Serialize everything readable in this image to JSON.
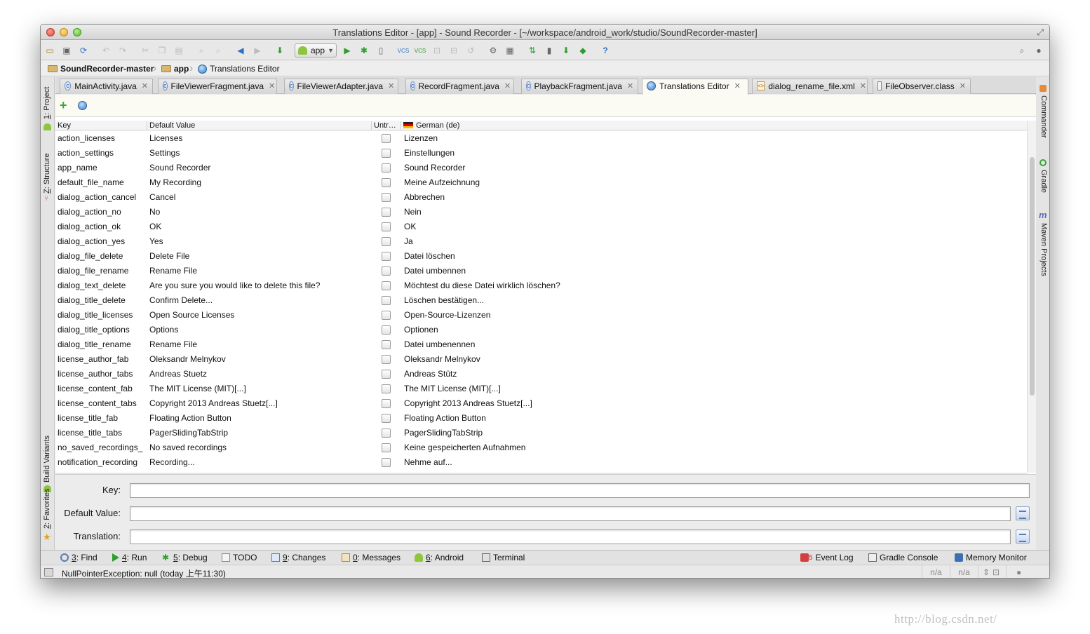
{
  "window": {
    "title": "Translations Editor - [app] - Sound Recorder - [~/workspace/android_work/studio/SoundRecorder-master]"
  },
  "toolbar": {
    "run_config": "app",
    "vcs_update_label": "VCS",
    "vcs_commit_label": "VCS",
    "help_label": "?"
  },
  "breadcrumb": [
    "SoundRecorder-master",
    "app",
    "Translations Editor"
  ],
  "left_tool_tabs": {
    "project": {
      "num": "1",
      "label": ": Project"
    },
    "structure": {
      "num": "Z",
      "label": ": Structure"
    },
    "build_variants": "Build Variants",
    "favorites": {
      "num": "2",
      "label": ": Favorites"
    }
  },
  "right_tool_tabs": [
    "Commander",
    "Gradle",
    "Maven Projects"
  ],
  "editor_tabs": [
    {
      "label": "MainActivity.java",
      "kind": "class-icon"
    },
    {
      "label": "FileViewerFragment.java",
      "kind": "class-icon"
    },
    {
      "label": "FileViewerAdapter.java",
      "kind": "class-icon"
    },
    {
      "label": "RecordFragment.java",
      "kind": "class-icon"
    },
    {
      "label": "PlaybackFragment.java",
      "kind": "class-icon"
    },
    {
      "label": "Translations Editor",
      "kind": "globe-icon",
      "active": true
    },
    {
      "label": "dialog_rename_file.xml",
      "kind": "xml-icon"
    },
    {
      "label": "FileObserver.class",
      "kind": "classfile-icon"
    }
  ],
  "table": {
    "columns": [
      "Key",
      "Default Value",
      "Untr…",
      "German (de)"
    ],
    "rows": [
      {
        "key": "action_licenses",
        "default": "Licenses",
        "de": "Lizenzen"
      },
      {
        "key": "action_settings",
        "default": "Settings",
        "de": "Einstellungen"
      },
      {
        "key": "app_name",
        "default": "Sound Recorder",
        "de": "Sound Recorder"
      },
      {
        "key": "default_file_name",
        "default": "My Recording",
        "de": "Meine Aufzeichnung"
      },
      {
        "key": "dialog_action_cancel",
        "default": "Cancel",
        "de": "Abbrechen"
      },
      {
        "key": "dialog_action_no",
        "default": "No",
        "de": "Nein"
      },
      {
        "key": "dialog_action_ok",
        "default": "OK",
        "de": "OK"
      },
      {
        "key": "dialog_action_yes",
        "default": "Yes",
        "de": "Ja"
      },
      {
        "key": "dialog_file_delete",
        "default": "Delete File",
        "de": "Datei löschen"
      },
      {
        "key": "dialog_file_rename",
        "default": "Rename File",
        "de": "Datei umbennen"
      },
      {
        "key": "dialog_text_delete",
        "default": "Are you sure you would like to delete this file?",
        "de": "Möchtest du diese Datei wirklich löschen?"
      },
      {
        "key": "dialog_title_delete",
        "default": "Confirm Delete...",
        "de": "Löschen bestätigen..."
      },
      {
        "key": "dialog_title_licenses",
        "default": "Open Source Licenses",
        "de": "Open-Source-Lizenzen"
      },
      {
        "key": "dialog_title_options",
        "default": "Options",
        "de": "Optionen"
      },
      {
        "key": "dialog_title_rename",
        "default": "Rename File",
        "de": "Datei umbenennen"
      },
      {
        "key": "license_author_fab",
        "default": "Oleksandr Melnykov",
        "de": "Oleksandr Melnykov"
      },
      {
        "key": "license_author_tabs",
        "default": "Andreas Stuetz",
        "de": "Andreas Stütz"
      },
      {
        "key": "license_content_fab",
        "default": "The MIT License (MIT)[...]",
        "de": "The MIT License (MIT)[...]"
      },
      {
        "key": "license_content_tabs",
        "default": "Copyright 2013 Andreas Stuetz[...]",
        "de": "Copyright 2013 Andreas Stuetz[...]"
      },
      {
        "key": "license_title_fab",
        "default": "Floating Action Button",
        "de": "Floating Action Button"
      },
      {
        "key": "license_title_tabs",
        "default": "PagerSlidingTabStrip",
        "de": "PagerSlidingTabStrip"
      },
      {
        "key": "no_saved_recordings_",
        "default": "No saved recordings",
        "de": "Keine gespeicherten Aufnahmen"
      },
      {
        "key": "notification_recording",
        "default": "Recording...",
        "de": "Nehme auf..."
      }
    ]
  },
  "form": {
    "key_label": "Key:",
    "default_label": "Default Value:",
    "translation_label": "Translation:",
    "key_value": "",
    "default_value": "",
    "translation_value": ""
  },
  "tool_windows_left": [
    {
      "num": "3",
      "label": ": Find",
      "icon": "search-icon"
    },
    {
      "num": "4",
      "label": ": Run",
      "icon": "run-icon"
    },
    {
      "num": "5",
      "label": ": Debug",
      "icon": "bug-icon"
    },
    {
      "num": "",
      "label": "TODO",
      "icon": "todo-icon"
    },
    {
      "num": "9",
      "label": ": Changes",
      "icon": "changes-icon"
    },
    {
      "num": "0",
      "label": ": Messages",
      "icon": "messages-icon"
    },
    {
      "num": "6",
      "label": ": Android",
      "icon": "android-icon"
    },
    {
      "num": "",
      "label": "Terminal",
      "icon": "terminal-icon"
    }
  ],
  "tool_windows_right": [
    {
      "badge": "5",
      "label": "Event Log",
      "icon": "event-log-icon"
    },
    {
      "badge": "",
      "label": "Gradle Console",
      "icon": "gradle-console-icon"
    },
    {
      "badge": "",
      "label": "Memory Monitor",
      "icon": "memory-monitor-icon"
    }
  ],
  "status": {
    "message": "NullPointerException: null (today 上午11:30)",
    "cell1": "n/a",
    "cell2": "n/a"
  },
  "watermark": "http://blog.csdn.net/",
  "colors": {
    "accent_green": "#2f9e2f",
    "accent_blue": "#2c6fc6",
    "active_tab_bg": "#fbfbf4"
  }
}
